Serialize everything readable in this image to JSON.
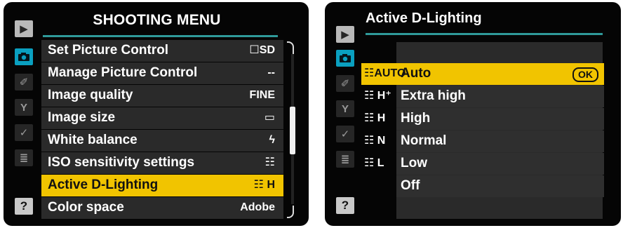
{
  "shooting_menu": {
    "title": "SHOOTING MENU",
    "tabs": [
      {
        "icon": "playback-icon",
        "glyph": "▶"
      },
      {
        "icon": "camera-icon",
        "glyph": ""
      },
      {
        "icon": "pencil-icon",
        "glyph": "✐"
      },
      {
        "icon": "wrench-icon",
        "glyph": "Y"
      },
      {
        "icon": "retouch-icon",
        "glyph": "✓"
      },
      {
        "icon": "my-menu-icon",
        "glyph": "≣"
      },
      {
        "icon": "help-icon",
        "glyph": "?"
      }
    ],
    "items": [
      {
        "label": "Set Picture Control",
        "value": "☐SD"
      },
      {
        "label": "Manage Picture Control",
        "value": "--"
      },
      {
        "label": "Image quality",
        "value": "FINE"
      },
      {
        "label": "Image size",
        "value": "▭"
      },
      {
        "label": "White balance",
        "value": "ϟ"
      },
      {
        "label": "ISO sensitivity settings",
        "value": "☷"
      },
      {
        "label": "Active D-Lighting",
        "value": "☷ H"
      },
      {
        "label": "Color space",
        "value": "Adobe"
      }
    ],
    "selected_index": 6
  },
  "active_d_lighting": {
    "title": "Active D-Lighting",
    "tabs": [
      {
        "icon": "playback-icon",
        "glyph": "▶"
      },
      {
        "icon": "camera-icon",
        "glyph": ""
      },
      {
        "icon": "pencil-icon",
        "glyph": "✐"
      },
      {
        "icon": "wrench-icon",
        "glyph": "Y"
      },
      {
        "icon": "retouch-icon",
        "glyph": "✓"
      },
      {
        "icon": "my-menu-icon",
        "glyph": "≣"
      },
      {
        "icon": "help-icon",
        "glyph": "?"
      }
    ],
    "options": [
      {
        "code": "☷AUTO",
        "label": "Auto"
      },
      {
        "code": "☷ H⁺",
        "label": "Extra high"
      },
      {
        "code": "☷ H",
        "label": "High"
      },
      {
        "code": "☷ N",
        "label": "Normal"
      },
      {
        "code": "☷ L",
        "label": "Low"
      },
      {
        "code": "",
        "label": "Off"
      }
    ],
    "ok_label": "OK",
    "selected_index": 0
  },
  "colors": {
    "background": "#050505",
    "accent": "#2f9a9a",
    "selection": "#f1c400",
    "camera_tab": "#0aa0c0",
    "row": "#2a2a2a"
  }
}
